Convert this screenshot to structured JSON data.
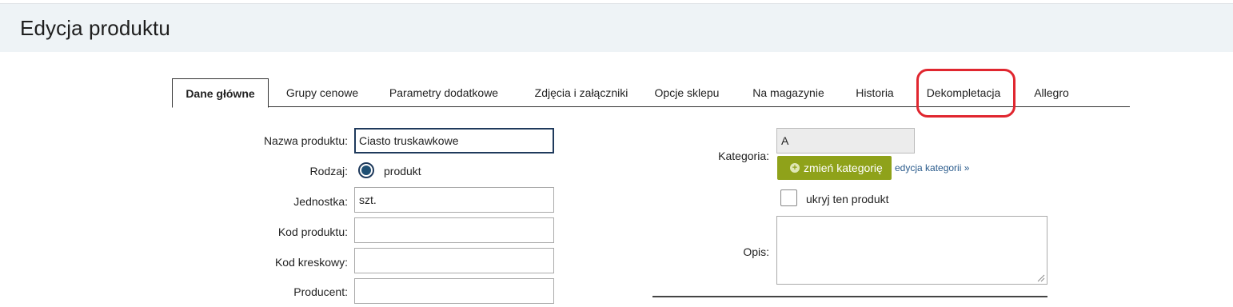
{
  "header": {
    "title": "Edycja produktu"
  },
  "tabs": [
    {
      "label": "Dane główne",
      "active": true
    },
    {
      "label": "Grupy cenowe"
    },
    {
      "label": "Parametry dodatkowe"
    },
    {
      "label": "Zdjęcia i załączniki"
    },
    {
      "label": "Opcje sklepu"
    },
    {
      "label": "Na magazynie"
    },
    {
      "label": "Historia"
    },
    {
      "label": "Dekompletacja",
      "highlighted": true
    },
    {
      "label": "Allegro"
    }
  ],
  "form": {
    "name_label": "Nazwa produktu:",
    "name_value": "Ciasto truskawkowe",
    "type_label": "Rodzaj:",
    "type_option": "produkt",
    "unit_label": "Jednostka:",
    "unit_value": "szt.",
    "code_label": "Kod produktu:",
    "code_value": "",
    "barcode_label": "Kod kreskowy:",
    "barcode_value": "",
    "producer_label": "Producent:",
    "producer_value": ""
  },
  "side": {
    "category_label": "Kategoria:",
    "category_value": "A",
    "change_category_button": "zmień kategorię",
    "edit_category_link": "edycja kategorii »",
    "hide_product_label": "ukryj ten produkt",
    "hide_product_checked": false,
    "description_label": "Opis:",
    "description_value": ""
  },
  "colors": {
    "header_bg": "#eef3f6",
    "button_green": "#8fa21a",
    "highlight_red": "#e0262f",
    "link_blue": "#2a5b8c"
  }
}
